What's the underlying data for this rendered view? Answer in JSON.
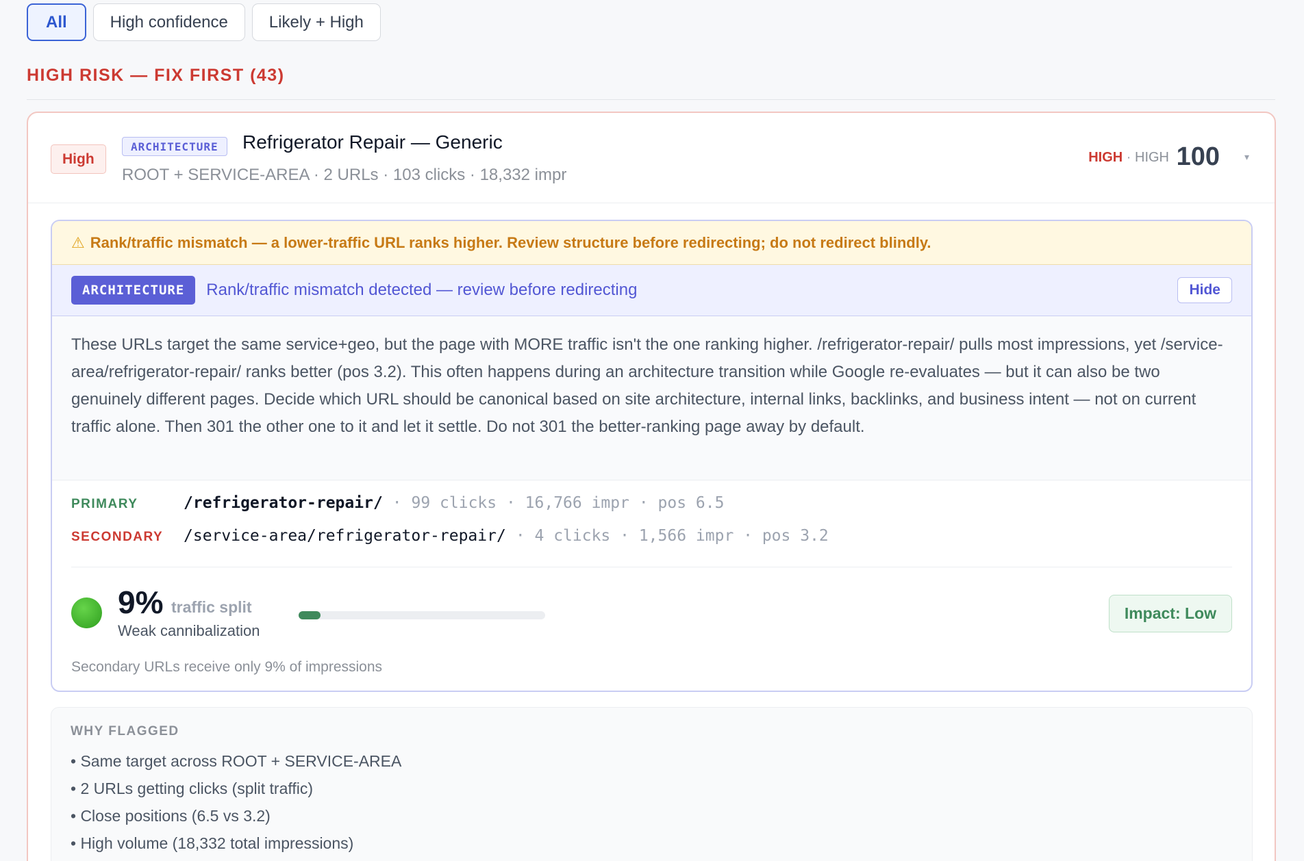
{
  "filters": [
    {
      "label": "All",
      "active": true
    },
    {
      "label": "High confidence",
      "active": false
    },
    {
      "label": "Likely + High",
      "active": false
    }
  ],
  "section": {
    "title": "HIGH RISK — FIX FIRST (43)"
  },
  "card": {
    "severity": "High",
    "tag": "ARCHITECTURE",
    "title": "Refrigerator Repair — Generic",
    "meta": "ROOT + SERVICE-AREA · 2 URLs · 103 clicks · 18,332 impr",
    "confidence_primary": "HIGH",
    "confidence_separator": "·",
    "confidence_secondary": "HIGH",
    "score": "100",
    "caret": "▾"
  },
  "warning": {
    "icon": "warning-icon",
    "text": "Rank/traffic mismatch — a lower-traffic URL ranks higher. Review structure before redirecting; do not redirect blindly."
  },
  "architecture": {
    "tag": "ARCHITECTURE",
    "headline": "Rank/traffic mismatch detected — review before redirecting",
    "hide_label": "Hide",
    "description": "These URLs target the same service+geo, but the page with MORE traffic isn't the one ranking higher. /refrigerator-repair/ pulls most impressions, yet /service-area/refrigerator-repair/ ranks better (pos 3.2). This often happens during an architecture transition while Google re-evaluates — but it can also be two genuinely different pages. Decide which URL should be canonical based on site architecture, internal links, backlinks, and business intent — not on current traffic alone. Then 301 the other one to it and let it settle. Do not 301 the better-ranking page away by default."
  },
  "urls": {
    "primary": {
      "label": "PRIMARY",
      "path": "/refrigerator-repair/",
      "stats": "· 99 clicks · 16,766 impr · pos 6.5"
    },
    "secondary": {
      "label": "SECONDARY",
      "path": "/service-area/refrigerator-repair/",
      "stats": "· 4 clicks · 1,566 impr · pos 3.2"
    }
  },
  "split": {
    "percent": "9%",
    "label": "traffic split",
    "status": "Weak cannibalization",
    "bar_fraction": 0.09,
    "impact": "Impact: Low",
    "note": "Secondary URLs receive only 9% of impressions"
  },
  "why": {
    "title": "WHY FLAGGED",
    "items": [
      "• Same target across ROOT + SERVICE-AREA",
      "• 2 URLs getting clicks (split traffic)",
      "• Close positions (6.5 vs 3.2)",
      "• High volume (18,332 total impressions)"
    ]
  },
  "colors": {
    "accent": "#3b63d6",
    "danger": "#cc3a32",
    "warning": "#c77a15",
    "indigo": "#5b5fd6",
    "success": "#3f8a5c"
  }
}
